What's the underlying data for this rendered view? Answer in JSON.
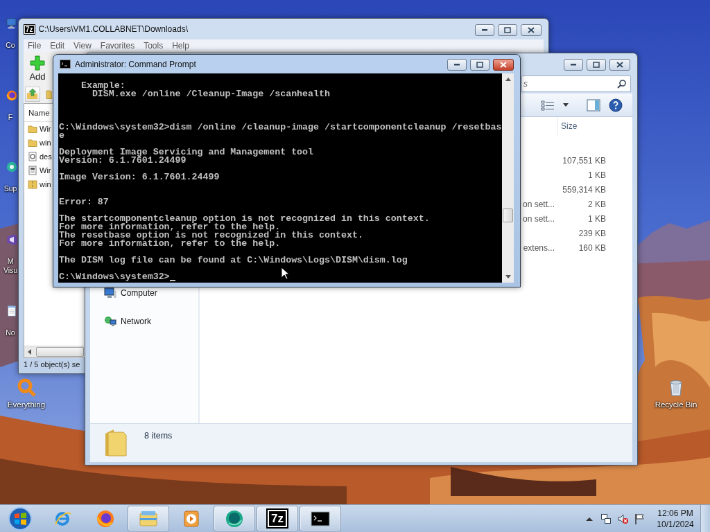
{
  "desktop_icons": [
    {
      "label": "Co",
      "kind": "computer"
    },
    {
      "label": "F",
      "kind": "browser"
    },
    {
      "label": "Sup",
      "kind": "support"
    },
    {
      "label": "M Visu",
      "kind": "studio"
    },
    {
      "label": "No",
      "kind": "notepad"
    },
    {
      "label": "Everything",
      "kind": "search"
    },
    {
      "label": "Recycle Bin",
      "kind": "recycle"
    }
  ],
  "archiver_window": {
    "logo": "7z",
    "title": "C:\\Users\\VM1.COLLABNET\\Downloads\\",
    "active": false,
    "menu": [
      "File",
      "Edit",
      "View",
      "Favorites",
      "Tools",
      "Help"
    ],
    "toolbar": [
      {
        "label": "Add",
        "kind": "add"
      }
    ],
    "columns": [
      "Name"
    ],
    "rows": [
      {
        "name": "Wir",
        "kind": "folder"
      },
      {
        "name": "win",
        "kind": "folder"
      },
      {
        "name": "des",
        "kind": "settings"
      },
      {
        "name": "Wir",
        "kind": "document"
      },
      {
        "name": "win",
        "kind": "archive"
      }
    ],
    "status_bar": "1 / 5 object(s) se"
  },
  "explorer_window": {
    "active": false,
    "search": {
      "placeholder": "s"
    },
    "columns": [
      "Size"
    ],
    "rows": [
      {
        "size": "107,551 KB"
      },
      {
        "size": "1 KB"
      },
      {
        "size": "559,314 KB"
      },
      {
        "type": "on sett...",
        "size": "2 KB"
      },
      {
        "type": "on sett...",
        "size": "1 KB"
      },
      {
        "size": "239 KB"
      },
      {
        "type": "extens...",
        "size": "160 KB"
      }
    ],
    "navigation": [
      {
        "label": "Computer",
        "kind": "computer"
      },
      {
        "label": "Network",
        "kind": "network"
      }
    ],
    "status_bar": "8 items"
  },
  "console_window": {
    "title": "Administrator: Command Prompt",
    "active": true,
    "output": "    Example:\n      DISM.exe /online /Cleanup-Image /scanhealth\n\n\n\nC:\\Windows\\system32>dism /online /cleanup-image /startcomponentcleanup /resetbas\ne\n\nDeployment Image Servicing and Management tool\nVersion: 6.1.7601.24499\n\nImage Version: 6.1.7601.24499\n\n\nError: 87\n\nThe startcomponentcleanup option is not recognized in this context.\nFor more information, refer to the help.\nThe resetbase option is not recognized in this context.\nFor more information, refer to the help.\n\nThe DISM log file can be found at C:\\Windows\\Logs\\DISM\\dism.log",
    "prompt": "C:\\Windows\\system32>"
  },
  "taskbar": {
    "items": [
      {
        "kind": "ie",
        "open": false
      },
      {
        "kind": "firefox",
        "open": false
      },
      {
        "kind": "explorer",
        "open": true
      },
      {
        "kind": "media",
        "open": false
      },
      {
        "kind": "app",
        "open": true
      },
      {
        "kind": "archiver",
        "logo": "7z",
        "open": true
      },
      {
        "kind": "console",
        "open": true
      }
    ],
    "clock": {
      "time": "12:06 PM",
      "date": "10/1/2024"
    }
  }
}
